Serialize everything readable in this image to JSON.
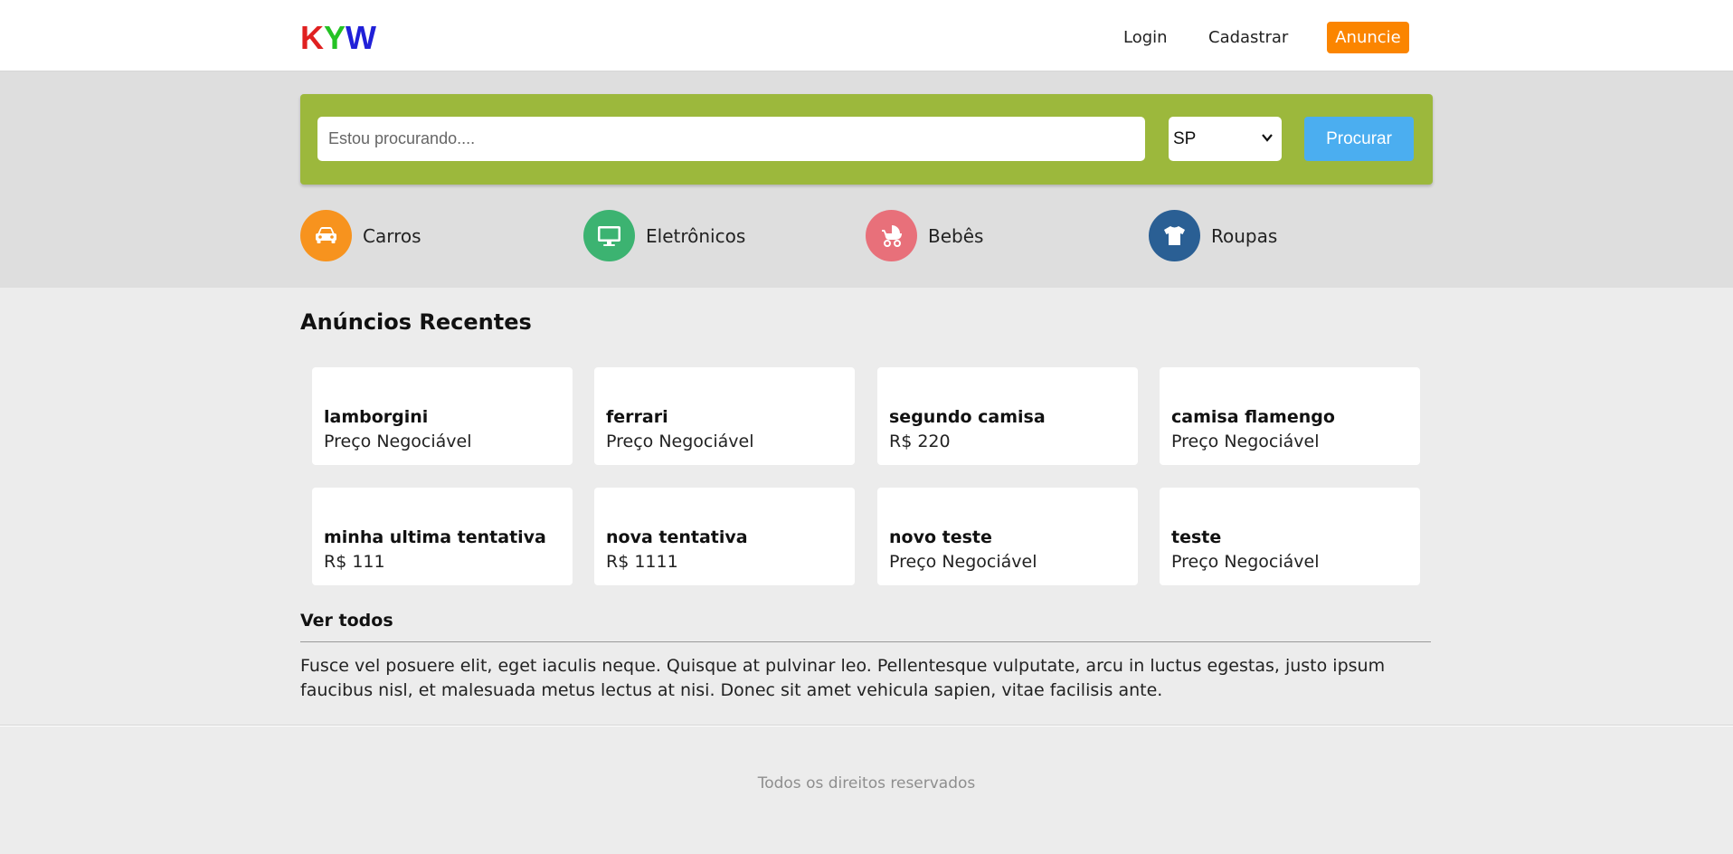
{
  "header": {
    "logo": [
      "K",
      "Y",
      "W"
    ],
    "nav": {
      "login": "Login",
      "register": "Cadastrar",
      "advertise": "Anuncie"
    }
  },
  "search": {
    "placeholder": "Estou procurando....",
    "state": "SP",
    "button": "Procurar"
  },
  "categories": [
    {
      "label": "Carros",
      "icon": "car-icon",
      "color": "#f7931e"
    },
    {
      "label": "Eletrônicos",
      "icon": "monitor-icon",
      "color": "#3cb371"
    },
    {
      "label": "Bebês",
      "icon": "baby-stroller-icon",
      "color": "#e8707a"
    },
    {
      "label": "Roupas",
      "icon": "tshirt-icon",
      "color": "#2a5f94"
    }
  ],
  "recent": {
    "title": "Anúncios Recentes",
    "items": [
      {
        "title": "lamborgini",
        "price": "Preço Negociável"
      },
      {
        "title": "ferrari",
        "price": "Preço Negociável"
      },
      {
        "title": "segundo camisa",
        "price": "R$ 220"
      },
      {
        "title": "camisa flamengo",
        "price": "Preço Negociável"
      },
      {
        "title": "minha ultima tentativa",
        "price": "R$ 111"
      },
      {
        "title": "nova tentativa",
        "price": "R$ 1111"
      },
      {
        "title": "novo teste",
        "price": "Preço Negociável"
      },
      {
        "title": "teste",
        "price": "Preço Negociável"
      }
    ],
    "see_all": "Ver todos"
  },
  "description": "Fusce vel posuere elit, eget iaculis neque. Quisque at pulvinar leo. Pellentesque vulputate, arcu in luctus egestas, justo ipsum faucibus nisl, et malesuada metus lectus at nisi. Donec sit amet vehicula sapien, vitae facilisis ante.",
  "footer": {
    "text": "Todos os direitos reservados"
  },
  "colors": {
    "accent_orange": "#fb8500",
    "search_green": "#9cb83c",
    "button_blue": "#4baef0"
  }
}
